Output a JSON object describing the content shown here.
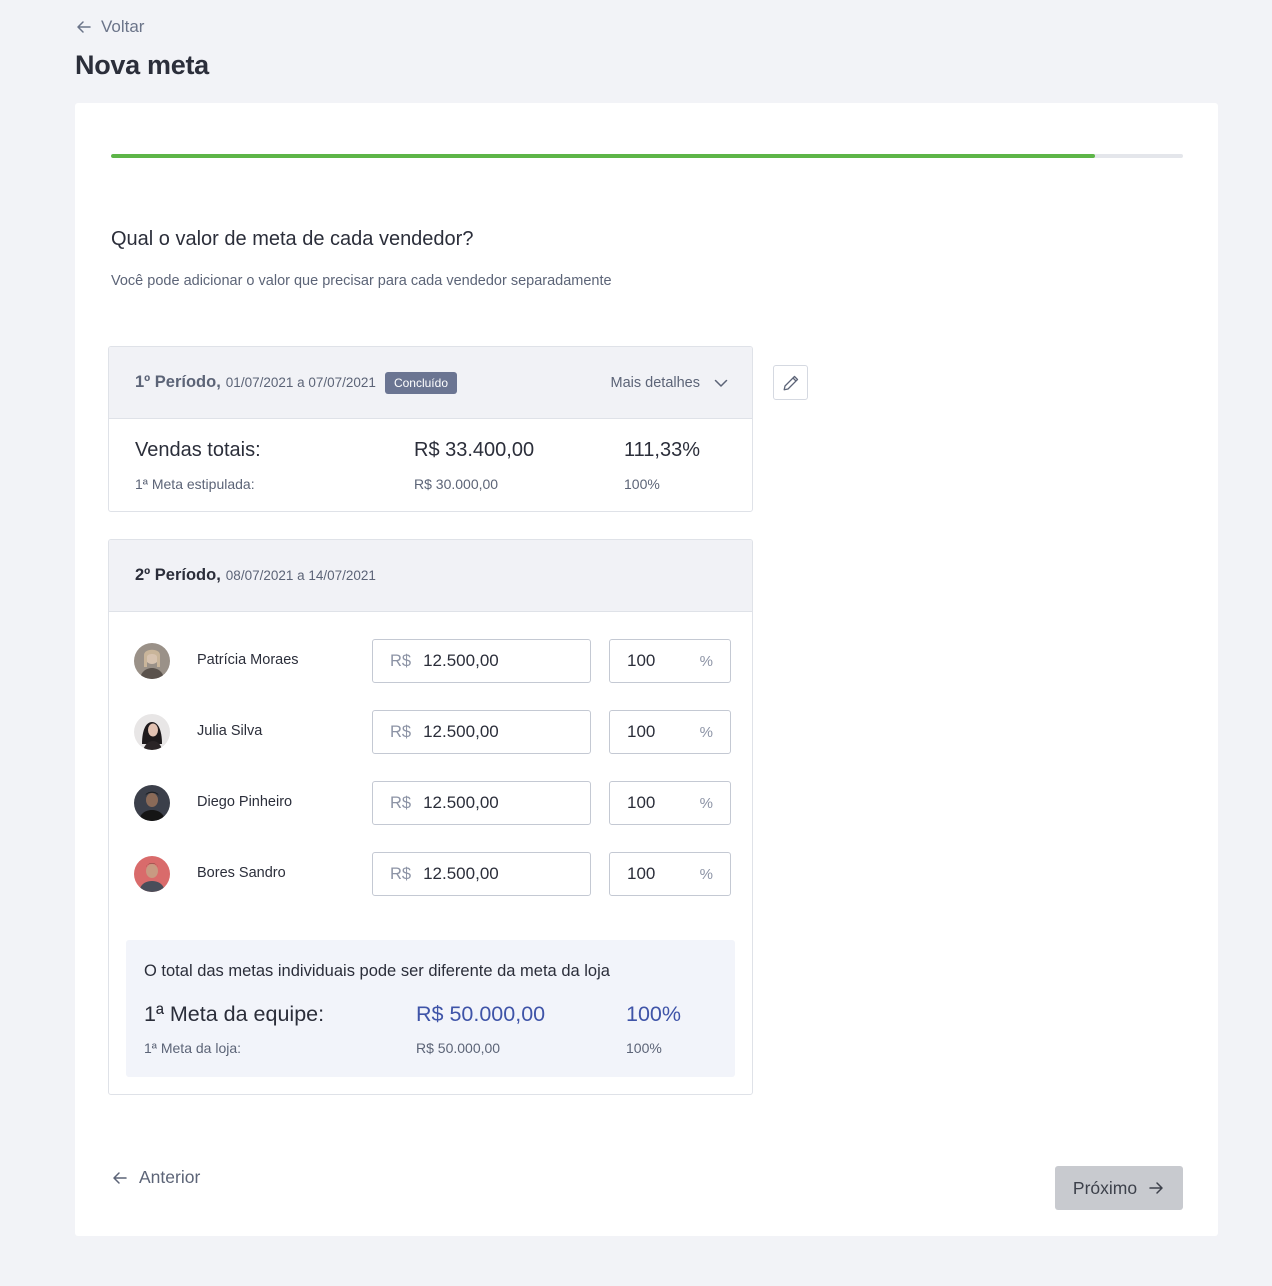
{
  "nav": {
    "back_label": "Voltar"
  },
  "page": {
    "title": "Nova meta"
  },
  "progress": {
    "fraction": 0.918
  },
  "step": {
    "question": "Qual o valor de meta de cada vendedor?",
    "subtitle": "Você pode adicionar o valor que precisar para cada vendedor separadamente"
  },
  "period1": {
    "name": "1º Período,",
    "dates": "01/07/2021 a 07/07/2021",
    "badge": "Concluído",
    "details_label": "Mais detalhes",
    "sales_label": "Vendas totais:",
    "sales_value": "R$ 33.400,00",
    "sales_pct": "111,33%",
    "goal_label": "1ª Meta estipulada:",
    "goal_value": "R$ 30.000,00",
    "goal_pct": "100%"
  },
  "period2": {
    "name": "2º Período,",
    "dates": "08/07/2021 a 14/07/2021",
    "currency": "R$",
    "pct_sign": "%",
    "sellers": [
      {
        "name": "Patrícia Moraes",
        "amount": "12.500,00",
        "pct": "100"
      },
      {
        "name": "Julia Silva",
        "amount": "12.500,00",
        "pct": "100"
      },
      {
        "name": "Diego Pinheiro",
        "amount": "12.500,00",
        "pct": "100"
      },
      {
        "name": "Bores Sandro",
        "amount": "12.500,00",
        "pct": "100"
      }
    ],
    "summary": {
      "note": "O total das metas individuais pode ser diferente da meta da loja",
      "team_label": "1ª Meta da equipe:",
      "team_value": "R$ 50.000,00",
      "team_pct": "100%",
      "store_label": "1ª Meta da loja:",
      "store_value": "R$ 50.000,00",
      "store_pct": "100%"
    }
  },
  "footer": {
    "prev_label": "Anterior",
    "next_label": "Próximo"
  },
  "colors": {
    "progress": "#5db548",
    "accent_blue": "#3f54a8",
    "badge": "#6b7592"
  }
}
